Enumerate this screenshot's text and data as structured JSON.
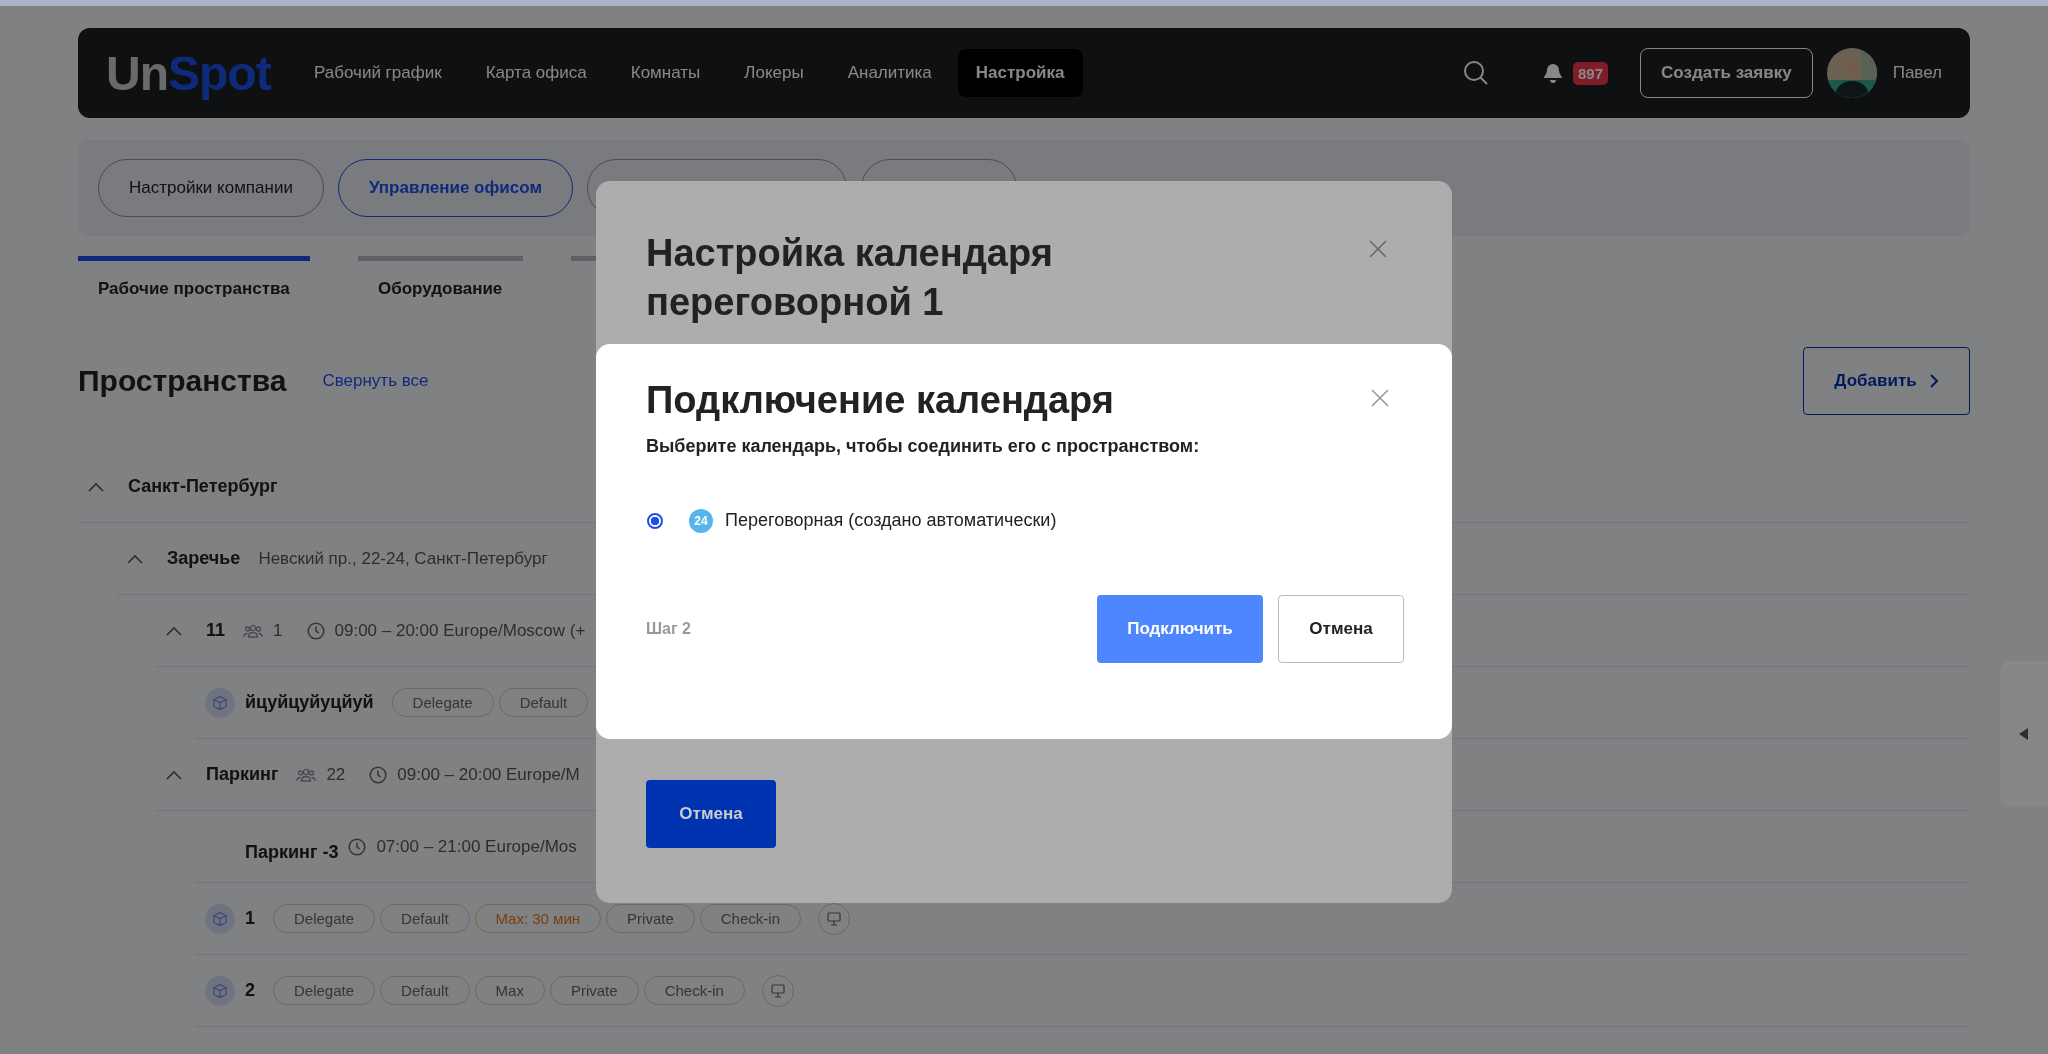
{
  "header": {
    "logo": {
      "part1": "Un",
      "part2": "Spot"
    },
    "nav": [
      {
        "label": "Рабочий график",
        "selected": false
      },
      {
        "label": "Карта офиса",
        "selected": false
      },
      {
        "label": "Комнаты",
        "selected": false
      },
      {
        "label": "Локеры",
        "selected": false
      },
      {
        "label": "Аналитика",
        "selected": false
      },
      {
        "label": "Настройка",
        "selected": true
      }
    ],
    "notifications_badge": "897",
    "create_button": "Создать заявку",
    "user_name": "Павел"
  },
  "settings_tabs": [
    {
      "label": "Настройки компании",
      "selected": false
    },
    {
      "label": "Управление офисом",
      "selected": true
    }
  ],
  "section_tabs": [
    {
      "label": "Рабочие пространства",
      "selected": true
    },
    {
      "label": "Оборудование",
      "selected": false
    }
  ],
  "heading": "Пространства",
  "collapse_link": "Свернуть все",
  "add_button": "Добавить",
  "tree": [
    {
      "kind": "group",
      "name": "Санкт-Петербург",
      "expanded": true,
      "children": [
        {
          "kind": "office",
          "name": "Заречье",
          "address": "Невский пр., 22-24, Санкт-Петербург",
          "expanded": true,
          "children": [
            {
              "kind": "floor",
              "name": "11",
              "capacity": "1",
              "hours": "09:00 – 20:00 Europe/Moscow (+",
              "expanded": true,
              "children": [
                {
                  "kind": "space",
                  "name": "йцуйцуйуцйуй",
                  "tags": [
                    {
                      "label": "Delegate",
                      "kind": "plain"
                    },
                    {
                      "label": "Default",
                      "kind": "plain"
                    }
                  ]
                }
              ]
            },
            {
              "kind": "floor",
              "name": "Паркинг",
              "capacity": "22",
              "hours": "09:00 – 20:00 Europe/M",
              "expanded": true,
              "children": [
                {
                  "kind": "subfloor",
                  "name": "Паркинг -3",
                  "hours": "07:00 – 21:00 Europe/Mos",
                  "children": [
                    {
                      "kind": "space",
                      "name": "1",
                      "monitor": true,
                      "tags": [
                        {
                          "label": "Delegate",
                          "kind": "plain"
                        },
                        {
                          "label": "Default",
                          "kind": "plain"
                        },
                        {
                          "label": "Max: 30 мин",
                          "kind": "warning"
                        },
                        {
                          "label": "Private",
                          "kind": "plain"
                        },
                        {
                          "label": "Check-in",
                          "kind": "plain"
                        }
                      ]
                    },
                    {
                      "kind": "space",
                      "name": "2",
                      "monitor": true,
                      "tags": [
                        {
                          "label": "Delegate",
                          "kind": "plain"
                        },
                        {
                          "label": "Default",
                          "kind": "plain"
                        },
                        {
                          "label": "Max",
                          "kind": "plain"
                        },
                        {
                          "label": "Private",
                          "kind": "plain"
                        },
                        {
                          "label": "Check-in",
                          "kind": "plain"
                        }
                      ]
                    }
                  ]
                }
              ]
            }
          ]
        }
      ]
    }
  ],
  "back_dialog": {
    "title": "Настройка календаря переговорной 1",
    "cancel_button": "Отмена"
  },
  "dialog": {
    "title": "Подключение календаря",
    "subtitle": "Выберите календарь, чтобы соединить его с пространством:",
    "options": [
      {
        "icon_text": "24",
        "label": "Переговорная (создано автоматически)",
        "selected": true
      }
    ],
    "step": "Шаг 2",
    "connect_button": "Подключить",
    "cancel_button": "Отмена"
  }
}
